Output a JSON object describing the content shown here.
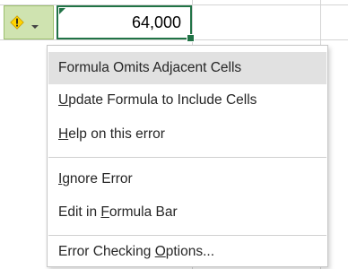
{
  "cell": {
    "value": "64,000"
  },
  "smart_tag": {
    "icon": "warning-icon",
    "dropdown_icon": "chevron-down-icon",
    "colors": {
      "background": "#cfe3b0",
      "icon_fill": "#ffd400"
    }
  },
  "menu": {
    "header": "Formula Omits Adjacent Cells",
    "items": [
      {
        "pre": "",
        "key": "U",
        "post": "pdate Formula to Include Cells"
      },
      {
        "pre": "",
        "key": "H",
        "post": "elp on this error"
      },
      {
        "pre": "",
        "key": "I",
        "post": "gnore Error"
      },
      {
        "pre": "Edit in ",
        "key": "F",
        "post": "ormula Bar"
      },
      {
        "pre": "Error Checking ",
        "key": "O",
        "post": "ptions..."
      }
    ]
  },
  "colors": {
    "accent": "#217346",
    "menu_header_bg": "#e1e1e1"
  }
}
